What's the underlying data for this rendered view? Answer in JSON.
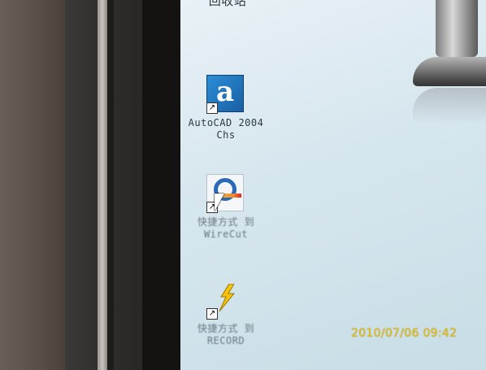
{
  "desktop": {
    "icons": [
      {
        "id": "recycle-bin",
        "label": "回收站"
      },
      {
        "id": "autocad",
        "label": "AutoCAD 2004\nChs",
        "glyph": "a"
      },
      {
        "id": "wirecut",
        "label": "快捷方式 到\nWireCut"
      },
      {
        "id": "record",
        "label": "快捷方式 到\nRECORD"
      }
    ],
    "shortcut_glyph": "↗"
  },
  "camera": {
    "timestamp": "2010/07/06 09:42"
  },
  "colors": {
    "screen_bg": "#d6e6ee",
    "autocad_blue": "#2b8ed6",
    "timestamp_yellow": "#e4c21f"
  }
}
